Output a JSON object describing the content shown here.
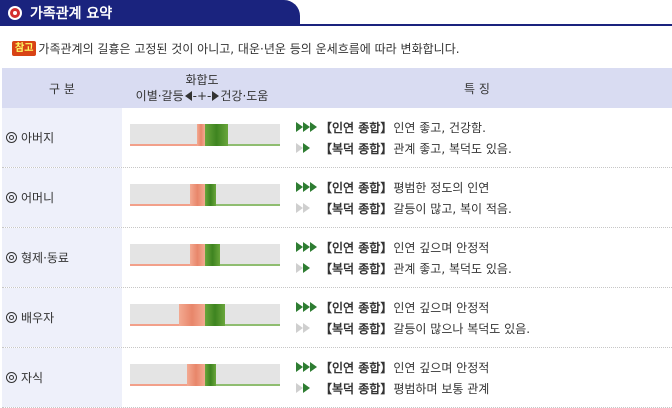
{
  "header": {
    "title": "가족관계 요약",
    "icon": "target-icon",
    "bar_color": "#1a237e"
  },
  "note": {
    "badge": "참고",
    "text": "가족관계의 길흉은 고정된 것이 아니고, 대운·년운 등의 운세흐름에 따라 변화합니다."
  },
  "table": {
    "col_category": "구 분",
    "col_scale_title": "화합도",
    "col_scale_left": "이별·갈등",
    "col_scale_mid": "-+-",
    "col_scale_right": "건강·도움",
    "col_features": "특 징",
    "rows": [
      {
        "name": "아버지",
        "neg_level": 0.05,
        "pos_level": 0.15,
        "lines": [
          {
            "arrow": "strong",
            "label": "【인연 종합】",
            "text": "인연 좋고, 건강함."
          },
          {
            "arrow": "medium",
            "label": "【복덕 종합】",
            "text": "관계 좋고, 복덕도 있음."
          }
        ]
      },
      {
        "name": "어머니",
        "neg_level": 0.1,
        "pos_level": 0.07,
        "lines": [
          {
            "arrow": "strong",
            "label": "【인연 종합】",
            "text": "평범한 정도의 인연"
          },
          {
            "arrow": "weak",
            "label": "【복덕 종합】",
            "text": "갈등이 많고, 복이 적음."
          }
        ]
      },
      {
        "name": "형제·동료",
        "neg_level": 0.1,
        "pos_level": 0.1,
        "lines": [
          {
            "arrow": "strong",
            "label": "【인연 종합】",
            "text": "인연 깊으며 안정적"
          },
          {
            "arrow": "medium",
            "label": "【복덕 종합】",
            "text": "관계 좋고, 복덕도 있음."
          }
        ]
      },
      {
        "name": "배우자",
        "neg_level": 0.17,
        "pos_level": 0.13,
        "lines": [
          {
            "arrow": "strong",
            "label": "【인연 종합】",
            "text": "인연 깊으며 안정적"
          },
          {
            "arrow": "weak",
            "label": "【복덕 종합】",
            "text": "갈등이 많으나 복덕도 있음."
          }
        ]
      },
      {
        "name": "자식",
        "neg_level": 0.12,
        "pos_level": 0.07,
        "lines": [
          {
            "arrow": "strong",
            "label": "【인연 종합】",
            "text": "인연 깊으며 안정적"
          },
          {
            "arrow": "medium",
            "label": "【복덕 종합】",
            "text": "평범하며 보통 관계"
          }
        ]
      }
    ]
  }
}
